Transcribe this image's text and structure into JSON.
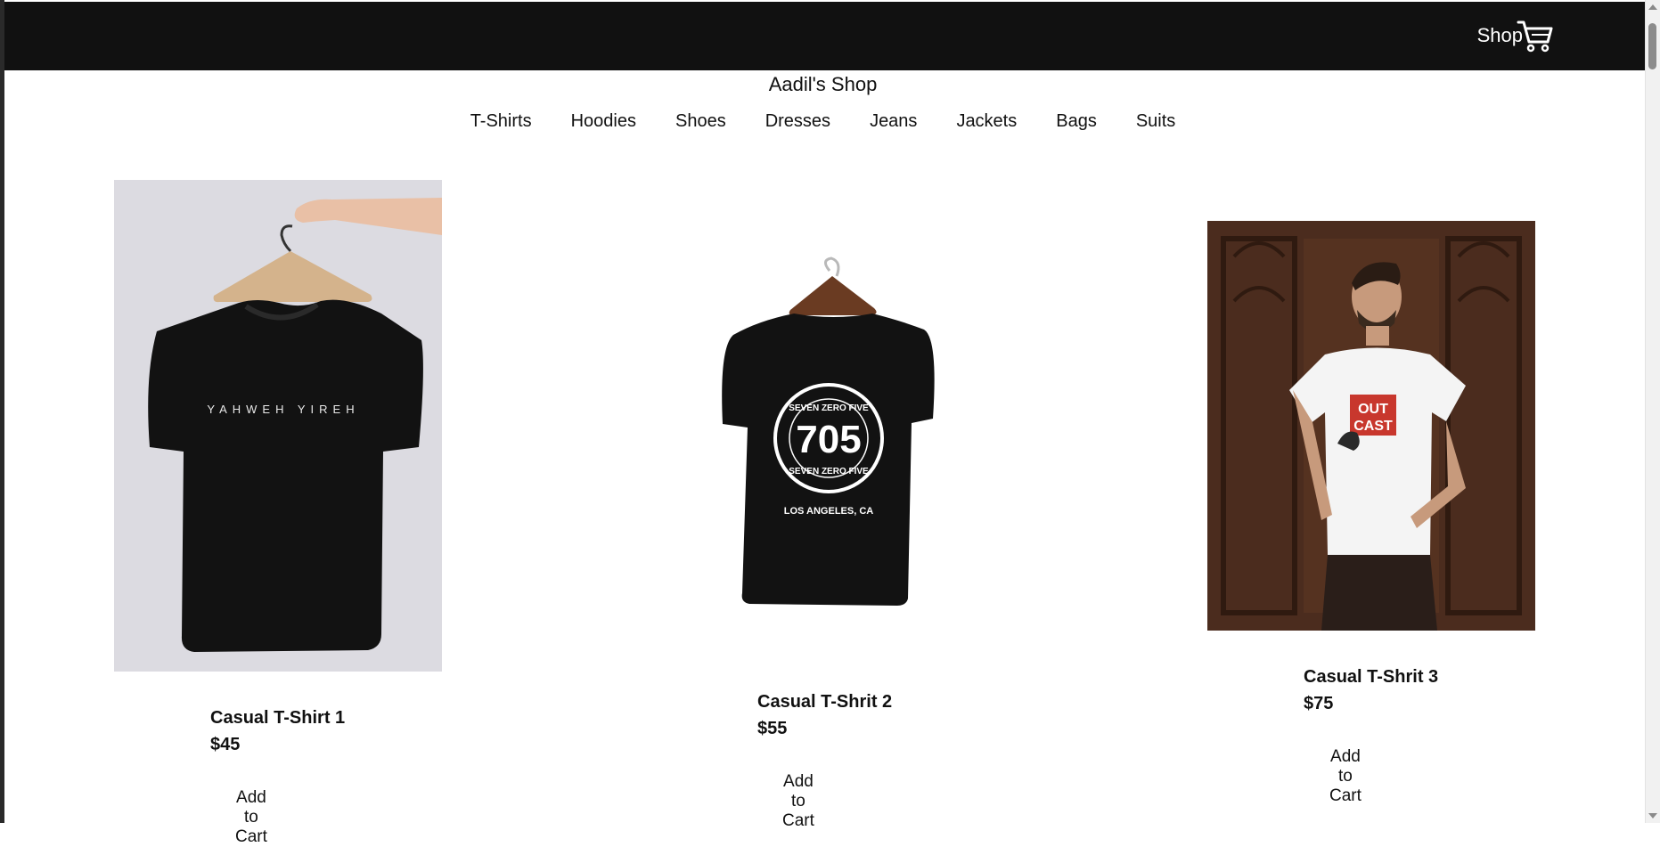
{
  "header": {
    "shop_label": "Shop",
    "cart_icon": "cart-icon",
    "background": "#111111"
  },
  "site": {
    "title": "Aadil's Shop"
  },
  "nav": {
    "items": [
      "T-Shirts",
      "Hoodies",
      "Shoes",
      "Dresses",
      "Jeans",
      "Jackets",
      "Bags",
      "Suits"
    ]
  },
  "products": [
    {
      "name": "Casual T-Shirt 1",
      "price": "$45",
      "button": "Add to Cart",
      "image": {
        "shirt_color": "#111111",
        "print": "YAHWEH YIREH"
      }
    },
    {
      "name": "Casual T-Shrit 2",
      "price": "$55",
      "button": "Add to Cart",
      "image": {
        "shirt_color": "#111111",
        "print_top": "SEVEN ZERO FIVE",
        "print_number": "705",
        "print_bottom": "SEVEN ZERO FIVE",
        "print_city": "LOS ANGELES, CA"
      }
    },
    {
      "name": "Casual T-Shrit 3",
      "price": "$75",
      "button": "Add to Cart",
      "image": {
        "shirt_color": "#f5f5f5",
        "print_line1": "OUT",
        "print_line2": "CAST",
        "accent": "#c8372d"
      }
    }
  ]
}
